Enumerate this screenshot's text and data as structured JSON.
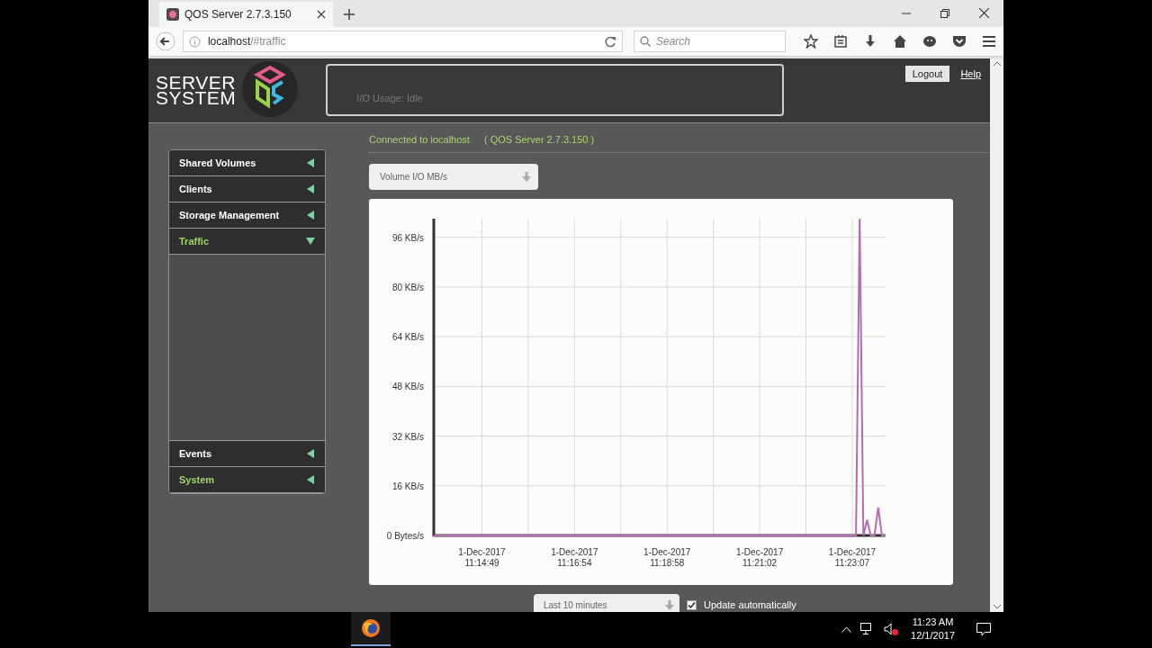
{
  "browser": {
    "tab_title": "QOS Server 2.7.3.150",
    "url_host": "localhost",
    "url_path": "/#traffic",
    "search_placeholder": "Search"
  },
  "header": {
    "logo_line1": "SERVER",
    "logo_line2": "SYSTEM",
    "io_usage": "I/O Usage: Idle",
    "logout": "Logout",
    "help": "Help"
  },
  "status": {
    "connected": "Connected to localhost",
    "server": "( QOS Server 2.7.3.150 )"
  },
  "sidebar": {
    "top_items": [
      {
        "label": "Shared Volumes",
        "highlighted": false,
        "expanded": false
      },
      {
        "label": "Clients",
        "highlighted": false,
        "expanded": false
      },
      {
        "label": "Storage Management",
        "highlighted": false,
        "expanded": false
      },
      {
        "label": "Traffic",
        "highlighted": true,
        "expanded": true
      }
    ],
    "bottom_items": [
      {
        "label": "Events",
        "highlighted": false,
        "expanded": false
      },
      {
        "label": "System",
        "highlighted": true,
        "expanded": false
      }
    ]
  },
  "metric_select": {
    "value": "Volume I/O MB/s"
  },
  "chart_data": {
    "type": "line",
    "grid": true,
    "ylim": [
      0,
      102
    ],
    "categories": [
      null,
      null,
      null,
      null,
      null,
      null,
      null,
      null,
      null,
      null,
      null,
      null,
      null,
      "1-Dec-2017\n11:14:49",
      null,
      null,
      null,
      null,
      null,
      null,
      null,
      null,
      null,
      null,
      null,
      null,
      null,
      null,
      null,
      null,
      null,
      null,
      null,
      null,
      null,
      null,
      null,
      null,
      "1-Dec-2017\n11:16:54",
      null,
      null,
      null,
      null,
      null,
      null,
      null,
      null,
      null,
      null,
      null,
      null,
      null,
      null,
      null,
      null,
      null,
      null,
      null,
      null,
      null,
      null,
      null,
      null,
      "1-Dec-2017\n11:18:58",
      null,
      null,
      null,
      null,
      null,
      null,
      null,
      null,
      null,
      null,
      null,
      null,
      null,
      null,
      null,
      null,
      null,
      null,
      null,
      null,
      null,
      null,
      null,
      null,
      "1-Dec-2017\n11:21:02",
      null,
      null,
      null,
      null,
      null,
      null,
      null,
      null,
      null,
      null,
      null,
      null,
      null,
      null,
      null,
      null,
      null,
      null,
      null,
      null,
      null,
      null,
      null,
      null,
      "1-Dec-2017\n11:23:07",
      null,
      null,
      null,
      null,
      null,
      null,
      null,
      null,
      null
    ],
    "yticks": [
      {
        "value": 0,
        "label": "0 Bytes/s"
      },
      {
        "value": 16,
        "label": "16 KB/s"
      },
      {
        "value": 32,
        "label": "32 KB/s"
      },
      {
        "value": 48,
        "label": "48 KB/s"
      },
      {
        "value": 64,
        "label": "64 KB/s"
      },
      {
        "value": 80,
        "label": "80 KB/s"
      },
      {
        "value": 96,
        "label": "96 KB/s"
      }
    ],
    "series": [
      {
        "color": "#b46cb4",
        "values": [
          0,
          0,
          0,
          0,
          0,
          0,
          0,
          0,
          0,
          0,
          0,
          0,
          0,
          0,
          0,
          0,
          0,
          0,
          0,
          0,
          0,
          0,
          0,
          0,
          0,
          0,
          0,
          0,
          0,
          0,
          0,
          0,
          0,
          0,
          0,
          0,
          0,
          0,
          0,
          0,
          0,
          0,
          0,
          0,
          0,
          0,
          0,
          0,
          0,
          0,
          0,
          0,
          0,
          0,
          0,
          0,
          0,
          0,
          0,
          0,
          0,
          0,
          0,
          0,
          0,
          0,
          0,
          0,
          0,
          0,
          0,
          0,
          0,
          0,
          0,
          0,
          0,
          0,
          0,
          0,
          0,
          0,
          0,
          0,
          0,
          0,
          0,
          0,
          0,
          0,
          0,
          0,
          0,
          0,
          0,
          0,
          0,
          0,
          0,
          0,
          0,
          0,
          0,
          0,
          0,
          0,
          0,
          0,
          0,
          0,
          0,
          0,
          0,
          0,
          0,
          102,
          0,
          5,
          0,
          0,
          9,
          0,
          0
        ]
      }
    ]
  },
  "range_select": {
    "value": "Last 10 minutes"
  },
  "auto_update": {
    "label": "Update automatically",
    "checked": true
  },
  "taskbar": {
    "time": "11:23 AM",
    "date": "12/1/2017"
  }
}
